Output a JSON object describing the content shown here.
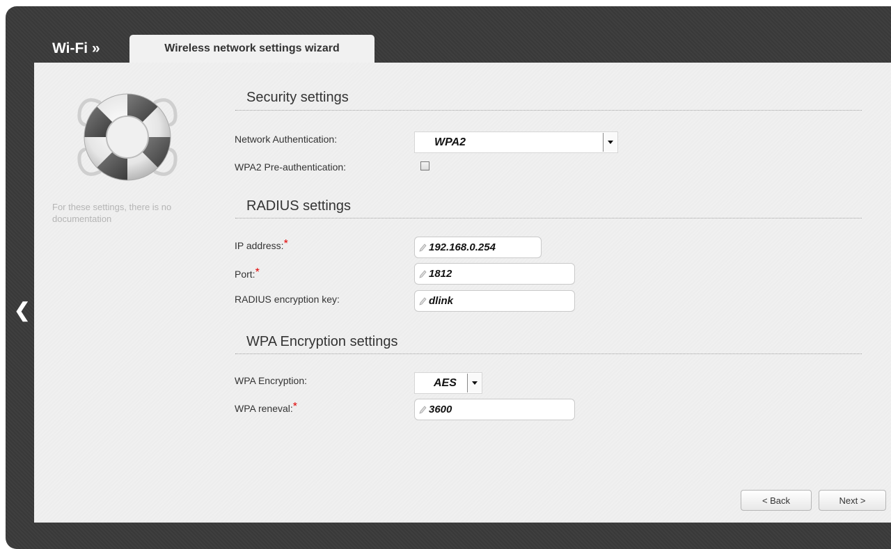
{
  "header": {
    "section_title": "Wi-Fi »",
    "tab_label": "Wireless network settings wizard"
  },
  "sidebar": {
    "nav_back_glyph": "❮",
    "help_icon": "lifebuoy-icon",
    "no_doc_text": "For these settings, there is no documentation"
  },
  "security": {
    "title": "Security settings",
    "auth_label": "Network Authentication:",
    "auth_value": "WPA2",
    "preauth_label": "WPA2 Pre-authentication:",
    "preauth_checked": false
  },
  "radius": {
    "title": "RADIUS settings",
    "ip_label": "IP address:",
    "ip_value": "192.168.0.254",
    "port_label": "Port:",
    "port_value": "1812",
    "key_label": "RADIUS encryption key:",
    "key_value": "dlink",
    "required_mark": "*"
  },
  "wpa": {
    "title": "WPA Encryption settings",
    "encryption_label": "WPA Encryption:",
    "encryption_value": "AES",
    "renewal_label": "WPA reneval:",
    "renewal_value": "3600",
    "required_mark": "*"
  },
  "buttons": {
    "back_label": "< Back",
    "next_label": "Next >"
  },
  "colors": {
    "frame": "#3b3b3b",
    "panel": "#f0f0f0",
    "required": "#e00000"
  }
}
